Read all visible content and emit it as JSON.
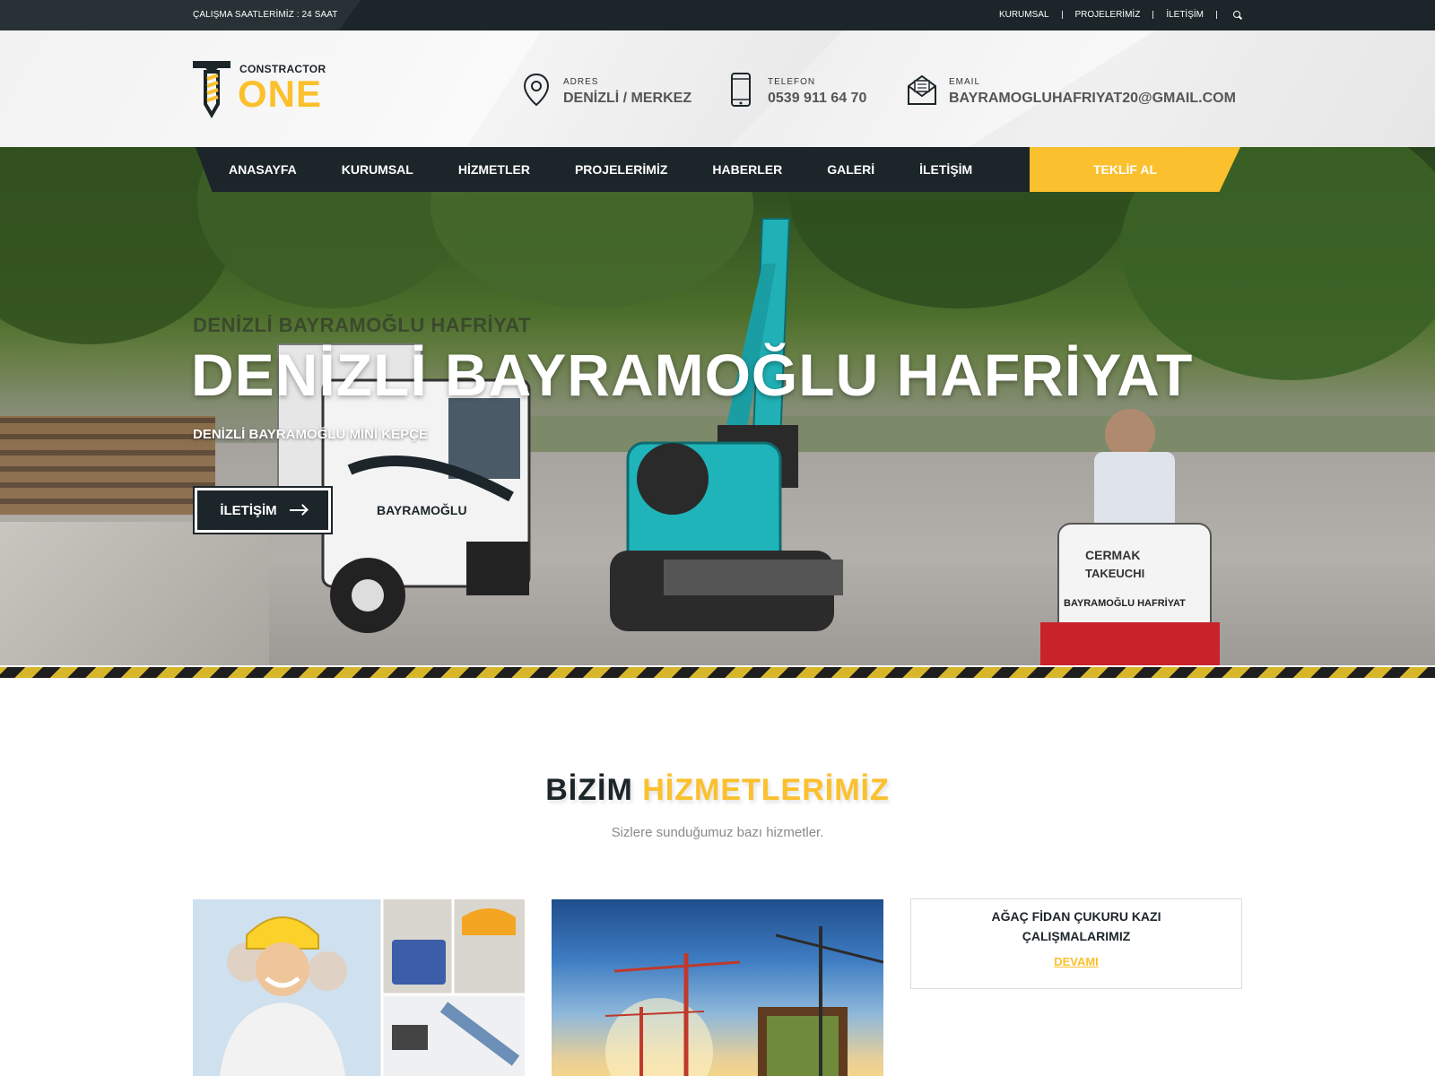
{
  "topbar": {
    "hours": "ÇALIŞMA SAATLERİMİZ : 24 SAAT",
    "links": [
      "KURUMSAL",
      "PROJELERİMİZ",
      "İLETİŞİM"
    ]
  },
  "logo": {
    "small": "CONSTRACTOR",
    "big": "ONE"
  },
  "contacts": {
    "address": {
      "label": "ADRES",
      "value": "DENİZLİ / MERKEZ"
    },
    "phone": {
      "label": "TELEFON",
      "value": "0539 911 64 70"
    },
    "email": {
      "label": "EMAIL",
      "value": "BAYRAMOGLUHAFRIYAT20@GMAIL.COM"
    }
  },
  "nav": {
    "items": [
      "ANASAYFA",
      "KURUMSAL",
      "HİZMETLER",
      "PROJELERİMİZ",
      "HABERLER",
      "GALERİ",
      "İLETİŞİM"
    ],
    "quote": "TEKLİF AL"
  },
  "hero": {
    "ghost_title": "DENİZLİ BAYRAMOĞLU HAFRİYAT",
    "title": "DENİZLİ BAYRAMOĞLU HAFRİYAT",
    "subtitle": "DENİZLİ BAYRAMOĞLU MİNİ KEPÇE",
    "cta": "İLETİŞİM",
    "image_labels": {
      "mini_brand": "CERMAK",
      "mini_model": "TAKEUCHI",
      "mini_owner": "BAYRAMOĞLU HAFRİYAT",
      "truck_owner": "BAYRAMOĞLU"
    }
  },
  "services": {
    "title_dark": "BİZİM",
    "title_accent": "HİZMETLERİMİZ",
    "subtitle": "Sizlere sunduğumuz bazı hizmetler.",
    "card3": {
      "title": "AĞAÇ FİDAN ÇUKURU KAZI ÇALIŞMALARIMIZ",
      "more": "DEVAMI"
    }
  },
  "colors": {
    "dark": "#1c2529",
    "accent": "#fbc02d",
    "muted": "#8a8a8a"
  }
}
